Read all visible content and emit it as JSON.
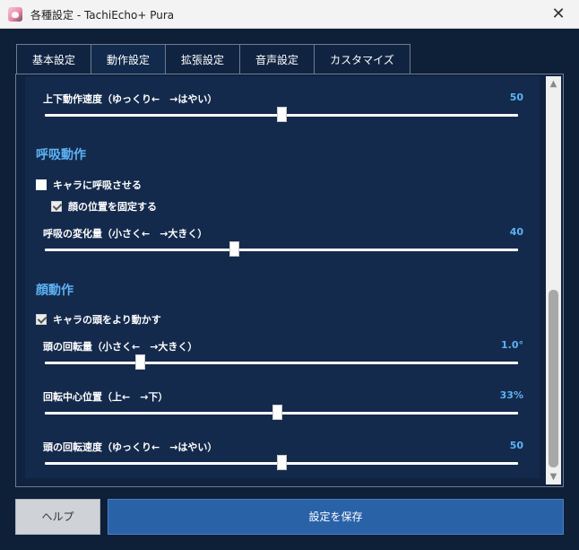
{
  "window": {
    "title": "各種設定 - TachiEcho+ Pura",
    "close_glyph": "✕"
  },
  "tabs": [
    {
      "label": "基本設定"
    },
    {
      "label": "動作設定"
    },
    {
      "label": "拡張設定"
    },
    {
      "label": "音声設定"
    },
    {
      "label": "カスタマイズ"
    }
  ],
  "settings": {
    "updown_speed": {
      "label": "上下動作速度（ゆっくり←　→はやい）",
      "value": "50",
      "level": 0.5
    },
    "breath_heading": "呼吸動作",
    "breath_enable": {
      "label": "キャラに呼吸させる",
      "checked": false
    },
    "face_fix": {
      "label": "顔の位置を固定する",
      "checked": true
    },
    "breath_amount": {
      "label": "呼吸の変化量（小さく←　→大きく）",
      "value": "40",
      "level": 0.4
    },
    "head_heading": "顔動作",
    "head_move_more": {
      "label": "キャラの頭をより動かす",
      "checked": false
    },
    "head_rotation": {
      "label": "頭の回転量（小さく←　→大きく）",
      "value": "1.0°",
      "level": 0.2
    },
    "rotation_center": {
      "label": "回転中心位置（上←　→下）",
      "value": "33%",
      "level": 0.49
    },
    "head_speed": {
      "label": "頭の回転速度（ゆっくり←　→はやい）",
      "value": "50",
      "level": 0.5
    }
  },
  "footer": {
    "help": "ヘルプ",
    "save": "設定を保存"
  },
  "colors": {
    "accent": "#5db2f5",
    "background": "#142a4c",
    "save_button": "#2a62a8"
  }
}
